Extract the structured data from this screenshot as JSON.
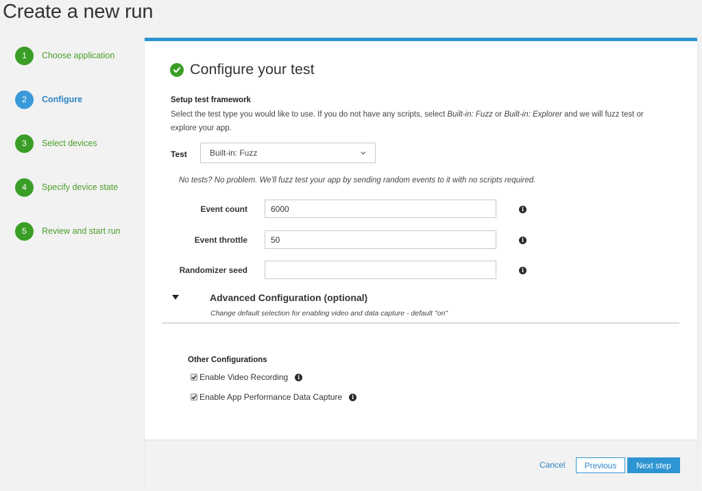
{
  "page": {
    "title": "Create a new run"
  },
  "steps": [
    {
      "number": "1",
      "label": "Choose application",
      "state": "complete"
    },
    {
      "number": "2",
      "label": "Configure",
      "state": "active"
    },
    {
      "number": "3",
      "label": "Select devices",
      "state": "pending"
    },
    {
      "number": "4",
      "label": "Specify device state",
      "state": "pending"
    },
    {
      "number": "5",
      "label": "Review and start run",
      "state": "pending"
    }
  ],
  "configure": {
    "title": "Configure your test",
    "framework_title": "Setup test framework",
    "framework_desc_1": "Select the test type you would like to use. If you do not have any scripts, select ",
    "framework_desc_fuzz": "Built-in: Fuzz",
    "framework_desc_2": " or ",
    "framework_desc_explorer": "Built-in: Explorer",
    "framework_desc_3": " and we will fuzz test or explore your app.",
    "test_label": "Test",
    "test_value": "Built-in: Fuzz",
    "no_tests_msg": "No tests? No problem. We'll fuzz test your app by sending random events to it with no scripts required."
  },
  "fields": {
    "event_count": {
      "label": "Event count",
      "value": "6000"
    },
    "event_throttle": {
      "label": "Event throttle",
      "value": "50"
    },
    "randomizer_seed": {
      "label": "Randomizer seed",
      "value": ""
    }
  },
  "advanced": {
    "title": "Advanced Configuration (optional)",
    "desc": "Change default selection for enabling video and data capture - default \"on\""
  },
  "other": {
    "title": "Other Configurations",
    "video_label": "Enable Video Recording",
    "perf_label": "Enable App Performance Data Capture",
    "video_checked": true,
    "perf_checked": true
  },
  "footer": {
    "cancel": "Cancel",
    "previous": "Previous",
    "next": "Next step"
  },
  "colors": {
    "accent_blue": "#2e95d3",
    "step_green": "#3a9e26",
    "step_blue": "#3a9ad9"
  }
}
